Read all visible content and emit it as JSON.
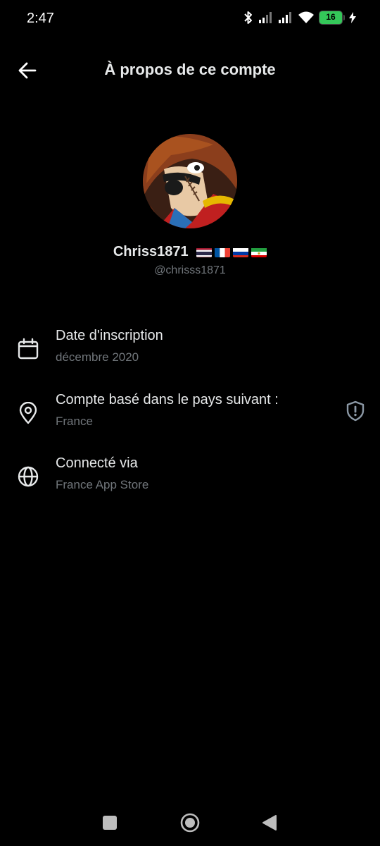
{
  "status": {
    "time": "2:47",
    "battery": "16",
    "battery_level_percent": 16
  },
  "header": {
    "title": "À propos de ce compte",
    "back_icon": "arrow-left-icon"
  },
  "profile": {
    "display_name": "Chriss1871",
    "flags": [
      "thailand-flag",
      "france-flag",
      "russia-flag",
      "iran-flag"
    ],
    "handle": "@chrisss1871"
  },
  "info": [
    {
      "icon": "calendar-icon",
      "title": "Date d'inscription",
      "value": "décembre 2020"
    },
    {
      "icon": "location-pin-icon",
      "title": "Compte basé dans le pays suivant :",
      "value": "France",
      "trailing_icon": "shield-alert-icon"
    },
    {
      "icon": "globe-icon",
      "title": "Connecté via",
      "value": "France App Store"
    }
  ],
  "navbar": {
    "buttons": [
      "recents-button",
      "home-button",
      "back-button"
    ]
  }
}
